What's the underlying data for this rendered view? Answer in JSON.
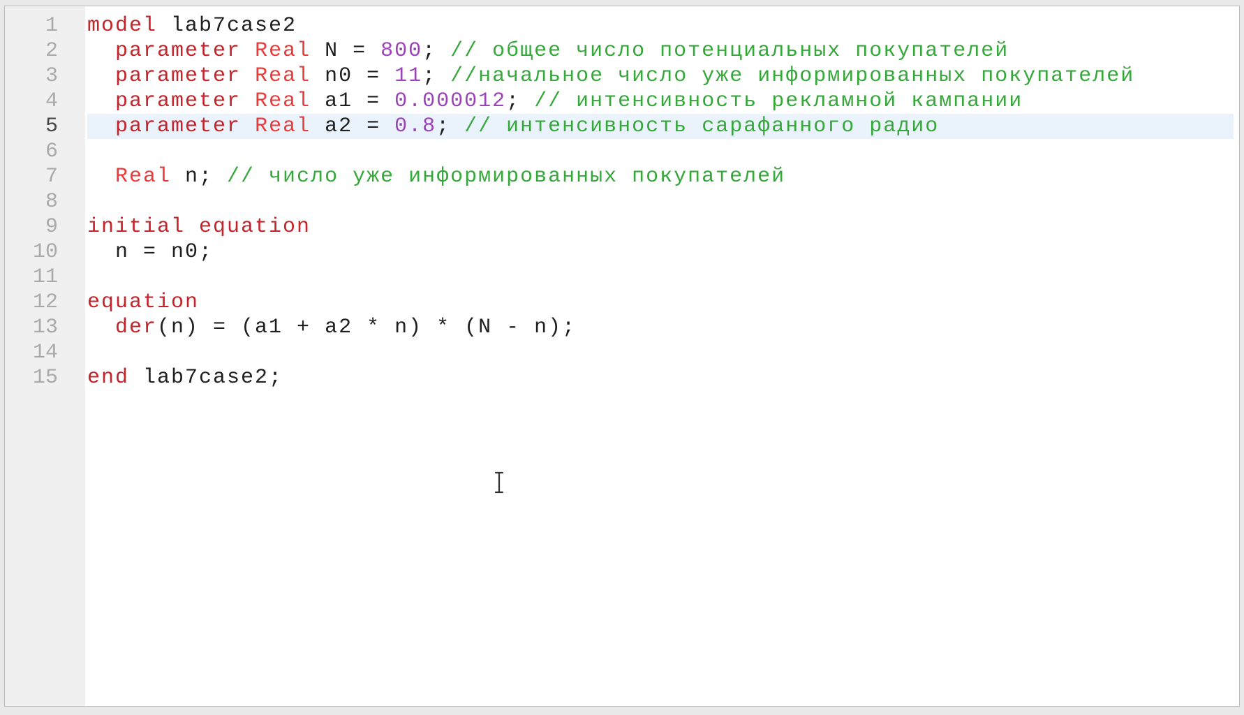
{
  "editor": {
    "current_line": 5,
    "lines": [
      {
        "num": "1",
        "tokens": [
          {
            "t": "model",
            "c": "kw"
          },
          {
            "t": " lab7case2",
            "c": ""
          }
        ]
      },
      {
        "num": "2",
        "tokens": [
          {
            "t": "  ",
            "c": ""
          },
          {
            "t": "parameter",
            "c": "kw"
          },
          {
            "t": " ",
            "c": ""
          },
          {
            "t": "Real",
            "c": "ty"
          },
          {
            "t": " N = ",
            "c": ""
          },
          {
            "t": "800",
            "c": "nm"
          },
          {
            "t": "; ",
            "c": ""
          },
          {
            "t": "// общее число потенциальных покупателей",
            "c": "cm"
          }
        ]
      },
      {
        "num": "3",
        "tokens": [
          {
            "t": "  ",
            "c": ""
          },
          {
            "t": "parameter",
            "c": "kw"
          },
          {
            "t": " ",
            "c": ""
          },
          {
            "t": "Real",
            "c": "ty"
          },
          {
            "t": " n0 = ",
            "c": ""
          },
          {
            "t": "11",
            "c": "nm"
          },
          {
            "t": "; ",
            "c": ""
          },
          {
            "t": "//начальное число уже информированных покупателей",
            "c": "cm"
          }
        ]
      },
      {
        "num": "4",
        "tokens": [
          {
            "t": "  ",
            "c": ""
          },
          {
            "t": "parameter",
            "c": "kw"
          },
          {
            "t": " ",
            "c": ""
          },
          {
            "t": "Real",
            "c": "ty"
          },
          {
            "t": " a1 = ",
            "c": ""
          },
          {
            "t": "0.000012",
            "c": "nm"
          },
          {
            "t": "; ",
            "c": ""
          },
          {
            "t": "// интенсивность рекламной кампании",
            "c": "cm"
          }
        ]
      },
      {
        "num": "5",
        "tokens": [
          {
            "t": "  ",
            "c": ""
          },
          {
            "t": "parameter",
            "c": "kw"
          },
          {
            "t": " ",
            "c": ""
          },
          {
            "t": "Real",
            "c": "ty"
          },
          {
            "t": " a2 = ",
            "c": ""
          },
          {
            "t": "0.8",
            "c": "nm"
          },
          {
            "t": "; ",
            "c": ""
          },
          {
            "t": "// интенсивность сарафанного радио",
            "c": "cm"
          }
        ]
      },
      {
        "num": "6",
        "tokens": []
      },
      {
        "num": "7",
        "tokens": [
          {
            "t": "  ",
            "c": ""
          },
          {
            "t": "Real",
            "c": "ty"
          },
          {
            "t": " n; ",
            "c": ""
          },
          {
            "t": "// число уже информированных покупателей",
            "c": "cm"
          }
        ]
      },
      {
        "num": "8",
        "tokens": []
      },
      {
        "num": "9",
        "tokens": [
          {
            "t": "initial equation",
            "c": "kw"
          }
        ]
      },
      {
        "num": "10",
        "tokens": [
          {
            "t": "  n = n0;",
            "c": ""
          }
        ]
      },
      {
        "num": "11",
        "tokens": []
      },
      {
        "num": "12",
        "tokens": [
          {
            "t": "equation",
            "c": "kw"
          }
        ]
      },
      {
        "num": "13",
        "tokens": [
          {
            "t": "  ",
            "c": ""
          },
          {
            "t": "der",
            "c": "kw"
          },
          {
            "t": "(n) = (a1 + a2 * n) * (N - n);",
            "c": ""
          }
        ]
      },
      {
        "num": "14",
        "tokens": []
      },
      {
        "num": "15",
        "tokens": [
          {
            "t": "end",
            "c": "kw"
          },
          {
            "t": " lab7case2;",
            "c": ""
          }
        ]
      }
    ]
  },
  "colors": {
    "keyword": "#c4232a",
    "type": "#ea3a3a",
    "number": "#9b43b8",
    "comment": "#35a83a",
    "current_line_bg": "#eaf2fb",
    "gutter_bg": "#f0f0f0"
  },
  "icons": {
    "text_cursor": "i-beam-cursor-icon"
  }
}
